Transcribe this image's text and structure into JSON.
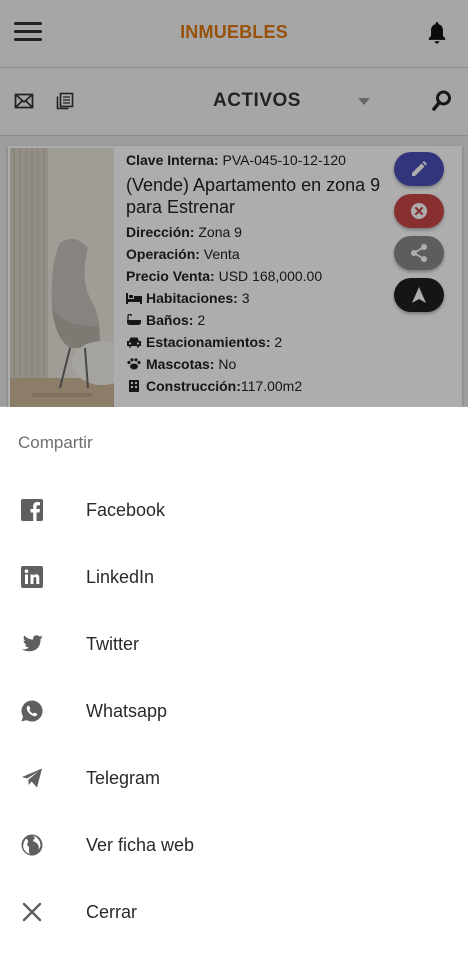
{
  "header": {
    "title": "INMUEBLES",
    "menu_icon": "menu-icon",
    "notifications_icon": "bell-icon"
  },
  "subheader": {
    "status_selected": "ACTIVOS"
  },
  "listing": {
    "clave_label": "Clave Interna:",
    "clave_value": "PVA-045-10-12-120",
    "headline": "(Vende) Apartamento en zona 9 para Estrenar",
    "direccion_label": "Dirección:",
    "direccion_value": "Zona 9",
    "operacion_label": "Operación:",
    "operacion_value": "Venta",
    "precio_label": "Precio Venta:",
    "precio_value": "USD 168,000.00",
    "habitaciones_label": "Habitaciones:",
    "habitaciones_value": "3",
    "banos_label": "Baños:",
    "banos_value": "2",
    "estacionamientos_label": "Estacionamientos:",
    "estacionamientos_value": "2",
    "mascotas_label": "Mascotas:",
    "mascotas_value": "No",
    "construccion_label": "Construcción:",
    "construccion_value": "117.00m2"
  },
  "actions": {
    "edit_color": "#4a4fb5",
    "delete_color": "#c94747",
    "share_color": "#8a8a8a",
    "navigate_color": "#1f1f1f"
  },
  "share_sheet": {
    "title": "Compartir",
    "options": [
      {
        "label": "Facebook",
        "icon": "facebook-icon"
      },
      {
        "label": "LinkedIn",
        "icon": "linkedin-icon"
      },
      {
        "label": "Twitter",
        "icon": "twitter-icon"
      },
      {
        "label": "Whatsapp",
        "icon": "whatsapp-icon"
      },
      {
        "label": "Telegram",
        "icon": "telegram-icon"
      },
      {
        "label": "Ver ficha web",
        "icon": "globe-icon"
      },
      {
        "label": "Cerrar",
        "icon": "close-icon"
      }
    ]
  }
}
